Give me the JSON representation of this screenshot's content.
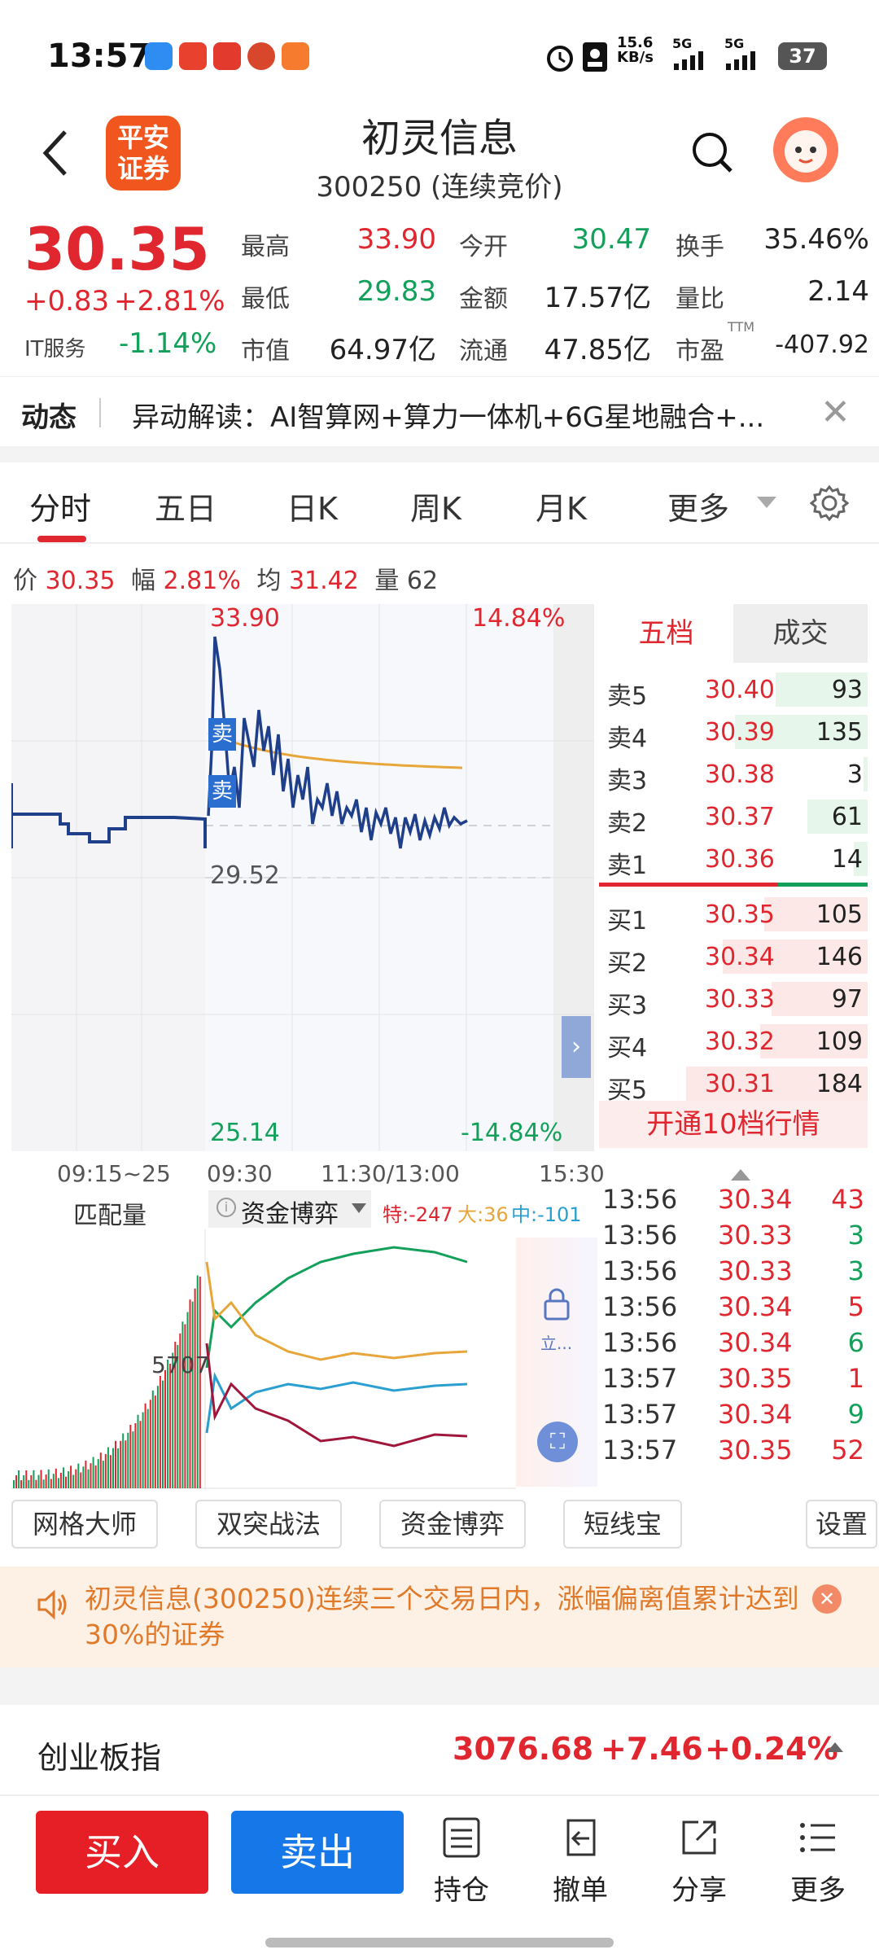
{
  "status_bar": {
    "time": "13:57",
    "net_speed": "15.6",
    "net_unit": "KB/s",
    "sig1": "5G",
    "sig2": "5G",
    "battery": "37"
  },
  "header": {
    "title": "初灵信息",
    "subtitle": "300250 (连续竞价)",
    "logo_line1": "平安",
    "logo_line2": "证券"
  },
  "quote": {
    "price": "30.35",
    "change": "+0.83",
    "change_pct": "+2.81%",
    "sector_name": "IT服务",
    "sector_pct": "-1.14%",
    "high_label": "最高",
    "high": "33.90",
    "low_label": "最低",
    "low": "29.83",
    "mktcap_label": "市值",
    "mktcap": "64.97亿",
    "open_label": "今开",
    "open": "30.47",
    "amount_label": "金额",
    "amount": "17.57亿",
    "float_label": "流通",
    "float": "47.85亿",
    "turnover_label": "换手",
    "turnover": "35.46%",
    "volratio_label": "量比",
    "volratio": "2.14",
    "pe_label": "市盈",
    "pe_sup": "TTM",
    "pe": "-407.92"
  },
  "news": {
    "tag": "动态",
    "text": "异动解读：AI智算网+算力一体机+6G星地融合+..."
  },
  "tabs": [
    "分时",
    "五日",
    "日K",
    "周K",
    "月K",
    "更多"
  ],
  "info_line": {
    "price_label": "价",
    "price": "30.35",
    "range_label": "幅",
    "range": "2.81%",
    "avg_label": "均",
    "avg": "31.42",
    "vol_label": "量",
    "vol": "62"
  },
  "chart_labels": {
    "top_price": "33.90",
    "top_pct": "14.84%",
    "mid_price": "29.52",
    "bottom_price": "25.14",
    "bottom_pct": "-14.84%",
    "sell_tag": "卖"
  },
  "time_axis": [
    "09:15~25",
    "09:30",
    "11:30/13:00",
    "15:30"
  ],
  "order_book": {
    "tab_active": "五档",
    "tab_other": "成交",
    "asks": [
      {
        "label": "卖5",
        "price": "30.40",
        "vol": "93",
        "bar": 0.47
      },
      {
        "label": "卖4",
        "price": "30.39",
        "vol": "135",
        "bar": 0.68
      },
      {
        "label": "卖3",
        "price": "30.38",
        "vol": "3",
        "bar": 0.02
      },
      {
        "label": "卖2",
        "price": "30.37",
        "vol": "61",
        "bar": 0.31
      },
      {
        "label": "卖1",
        "price": "30.36",
        "vol": "14",
        "bar": 0.07
      }
    ],
    "bids": [
      {
        "label": "买1",
        "price": "30.35",
        "vol": "105",
        "bar": 0.53
      },
      {
        "label": "买2",
        "price": "30.34",
        "vol": "146",
        "bar": 0.74
      },
      {
        "label": "买3",
        "price": "30.33",
        "vol": "97",
        "bar": 0.49
      },
      {
        "label": "买4",
        "price": "30.32",
        "vol": "109",
        "bar": 0.55
      },
      {
        "label": "买5",
        "price": "30.31",
        "vol": "184",
        "bar": 0.93
      }
    ],
    "open10": "开通10档行情"
  },
  "lower_panel": {
    "match_label": "匹配量",
    "fund_label": "资金博弈",
    "special": "特:-247",
    "big": "大:36",
    "mid": "中:-101",
    "peak": "5707",
    "lock_text": "立..."
  },
  "trades": [
    {
      "time": "13:56",
      "price": "30.34",
      "vol": "43",
      "dir": "up"
    },
    {
      "time": "13:56",
      "price": "30.33",
      "vol": "3",
      "dir": "down"
    },
    {
      "time": "13:56",
      "price": "30.33",
      "vol": "3",
      "dir": "down"
    },
    {
      "time": "13:56",
      "price": "30.34",
      "vol": "5",
      "dir": "up"
    },
    {
      "time": "13:56",
      "price": "30.34",
      "vol": "6",
      "dir": "down"
    },
    {
      "time": "13:57",
      "price": "30.35",
      "vol": "1",
      "dir": "up"
    },
    {
      "time": "13:57",
      "price": "30.34",
      "vol": "9",
      "dir": "down"
    },
    {
      "time": "13:57",
      "price": "30.35",
      "vol": "52",
      "dir": "up"
    }
  ],
  "strategy_chips": [
    "网格大师",
    "双突战法",
    "资金博弈",
    "短线宝"
  ],
  "settings_label": "设置",
  "banner": {
    "text": "初灵信息(300250)连续三个交易日内，涨幅偏离值累计达到30%的证券"
  },
  "index": {
    "name": "创业板指",
    "value": "3076.68",
    "change": "+7.46",
    "pct": "+0.24%"
  },
  "bottom_bar": {
    "buy": "买入",
    "sell": "卖出",
    "items": [
      "持仓",
      "撤单",
      "分享",
      "更多"
    ]
  },
  "colors": {
    "up": "#e0262e",
    "down": "#13a05a",
    "price_line": "#1f3f8a",
    "avg_line": "#e8a63a"
  }
}
